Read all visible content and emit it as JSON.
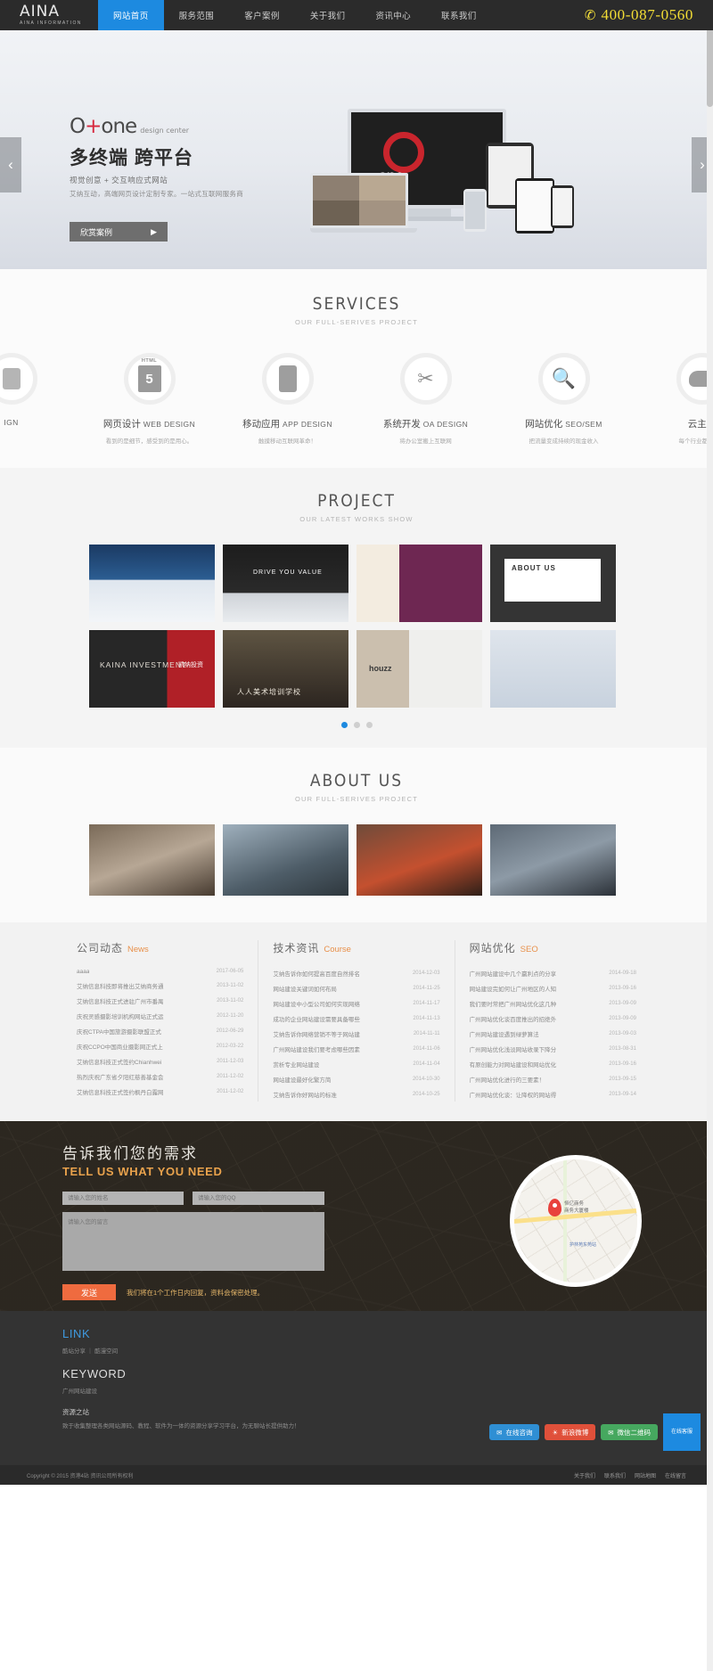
{
  "header": {
    "logo": "AINA",
    "logo_sub": "AINA INFORMATION",
    "nav": [
      {
        "label": "网站首页",
        "active": true
      },
      {
        "label": "服务范围",
        "active": false
      },
      {
        "label": "客户案例",
        "active": false
      },
      {
        "label": "关于我们",
        "active": false
      },
      {
        "label": "资讯中心",
        "active": false
      },
      {
        "label": "联系我们",
        "active": false
      }
    ],
    "phone": "400-087-0560",
    "phone_icon": "phone-icon"
  },
  "banner": {
    "logo_pre": "O",
    "logo_plus": "+",
    "logo_post": "one",
    "logo_tag": "design center",
    "title": "多终端 跨平台",
    "subtitle": "视觉创意 + 交互响应式网站",
    "desc": "艾纳互动，高端网页设计定制专家。一站式互联网服务商",
    "button": "欣赏案例",
    "button_arrow": "▶",
    "monitor_word": "one",
    "arrow_left": "‹",
    "arrow_right": "›"
  },
  "services": {
    "title": "SERVICES",
    "subtitle": "OUR FULL-SERIVES PROJECT",
    "items": [
      {
        "cn": "",
        "en": "IGN",
        "desc": "",
        "icon": "partial-icon"
      },
      {
        "cn": "网页设计",
        "en": "WEB DESIGN",
        "desc": "看到的是细节，感受到的是用心。",
        "icon": "html5-icon"
      },
      {
        "cn": "移动应用",
        "en": "APP DESIGN",
        "desc": "触摸移动互联网革命！",
        "icon": "tablet-icon"
      },
      {
        "cn": "系统开发",
        "en": "OA DESIGN",
        "desc": "将办公室搬上互联网",
        "icon": "tools-icon"
      },
      {
        "cn": "网站优化",
        "en": "SEO/SEM",
        "desc": "把流量变成持续的现金收入",
        "icon": "search-icon"
      },
      {
        "cn": "云主机",
        "en": "",
        "desc": "每个行业都应该有",
        "icon": "cloud-icon"
      }
    ]
  },
  "project": {
    "title": "PROJECT",
    "subtitle": "OUR LATEST WORKS SHOW",
    "cards": [
      {
        "name": "project-card-1",
        "label": ""
      },
      {
        "name": "project-card-2",
        "label": "DRIVE YOU VALUE"
      },
      {
        "name": "project-card-3",
        "label": ""
      },
      {
        "name": "project-card-4",
        "label": "ABOUT US"
      },
      {
        "name": "project-card-5",
        "label": "KAINA INVESTMENT"
      },
      {
        "name": "project-card-6",
        "label": ""
      },
      {
        "name": "project-card-7",
        "label": "houzz"
      },
      {
        "name": "project-card-8",
        "label": ""
      }
    ],
    "card5_sub": "凯纳投资",
    "card6_label": "人人美术培训学校",
    "dots": 3,
    "active_dot": 0
  },
  "about": {
    "title": "ABOUT US",
    "subtitle": "OUR FULL-SERIVES PROJECT",
    "cards": [
      "about-photo-meeting-room",
      "about-photo-office",
      "about-photo-lobby",
      "about-photo-conference"
    ]
  },
  "news": {
    "columns": [
      {
        "cn": "公司动态",
        "en": "News",
        "items": [
          {
            "title": "aaaa",
            "date": "2017-06-05"
          },
          {
            "title": "艾纳信息科技即将推出艾纳商务通",
            "date": "2013-11-02"
          },
          {
            "title": "艾纳信息科技正式进驻广州市番禺",
            "date": "2013-11-02"
          },
          {
            "title": "庆祝灵感摄影培训机构网站正式运",
            "date": "2012-11-20"
          },
          {
            "title": "庆祝CTPA中国旅游摄影联盟正式",
            "date": "2012-06-29"
          },
          {
            "title": "庆祝CCPO中国商业摄影网正式上",
            "date": "2012-03-22"
          },
          {
            "title": "艾纳信息科技正式签约Chianhwei",
            "date": "2011-12-03"
          },
          {
            "title": "热烈庆祝广东省夕阳红慈善基金会",
            "date": "2011-12-02"
          },
          {
            "title": "艾纳信息科技正式签约枫丹白露网",
            "date": "2011-12-02"
          }
        ]
      },
      {
        "cn": "技术资讯",
        "en": "Course",
        "items": [
          {
            "title": "艾纳告诉你如何提高百度自然排名",
            "date": "2014-12-03"
          },
          {
            "title": "网站建设关键词如何布局",
            "date": "2014-11-25"
          },
          {
            "title": "网站建设中小型公司如何实现网络",
            "date": "2014-11-17"
          },
          {
            "title": "成功的企业网站建设需要具备哪些",
            "date": "2014-11-13"
          },
          {
            "title": "艾纳告诉你网络营销不等于网站建",
            "date": "2014-11-11"
          },
          {
            "title": "广州网站建设我们要考虑哪些因素",
            "date": "2014-11-06"
          },
          {
            "title": "赏析专业网站建设",
            "date": "2014-11-04"
          },
          {
            "title": "网站建设最好化繁方简",
            "date": "2014-10-30"
          },
          {
            "title": "艾纳告诉你好网站的标准",
            "date": "2014-10-25"
          }
        ]
      },
      {
        "cn": "网站优化",
        "en": "SEO",
        "items": [
          {
            "title": "广州网站建设中几个赢利点的分享",
            "date": "2014-09-18"
          },
          {
            "title": "网站建设完如何让广州地区的人知",
            "date": "2013-09-16"
          },
          {
            "title": "我们要时常把广州网站优化这几种",
            "date": "2013-09-09"
          },
          {
            "title": "广州网站优化谈百度推出的招绝外",
            "date": "2013-09-09"
          },
          {
            "title": "广州网站建设遇到绿萝算法",
            "date": "2013-09-03"
          },
          {
            "title": "广州网站优化浅淡网站收录下降分",
            "date": "2013-08-31"
          },
          {
            "title": "有原创能力对网站建设和网站优化",
            "date": "2013-09-16"
          },
          {
            "title": "广州网站优化进行的三要素！",
            "date": "2013-09-15"
          },
          {
            "title": "广州网站优化谈：让降权的网站得",
            "date": "2013-09-14"
          }
        ]
      }
    ]
  },
  "contact": {
    "title_cn": "告诉我们您的需求",
    "title_en": "TELL US WHAT YOU NEED",
    "name_placeholder": "请输入您的姓名",
    "qq_placeholder": "请输入您的QQ",
    "message_placeholder": "请输入您的留言",
    "send_label": "发送",
    "note": "我们将在1个工作日内回复，资料会保密处理。",
    "map_label_1": "恒亿商务",
    "map_label_2": "商务大厦楼",
    "map_label_3": "护林苑东苑站"
  },
  "footer": {
    "link_title": "LINK",
    "link_items": "酷站分享 ｜ 酷漫空间",
    "keyword_title": "KEYWORD",
    "keyword_items": "广州网站建设",
    "bottom_title": "资源之站",
    "bottom_text": "致于收集整理各类网站源码、教程、软件为一体的资源分享学习平台，为无聊站长提供助力！",
    "copyright": "Copyright © 2015 资港4站 资讯公司所有权利",
    "links": [
      "关于我们",
      "联系我们",
      "网站地图",
      "在线留言"
    ],
    "chips": [
      {
        "label": "在线咨询",
        "color": "blue",
        "icon": "chat-icon"
      },
      {
        "label": "新浪微博",
        "color": "red",
        "icon": "weibo-icon"
      },
      {
        "label": "微信二维码",
        "color": "green",
        "icon": "wechat-icon"
      }
    ],
    "qr_label": "在线客服"
  }
}
